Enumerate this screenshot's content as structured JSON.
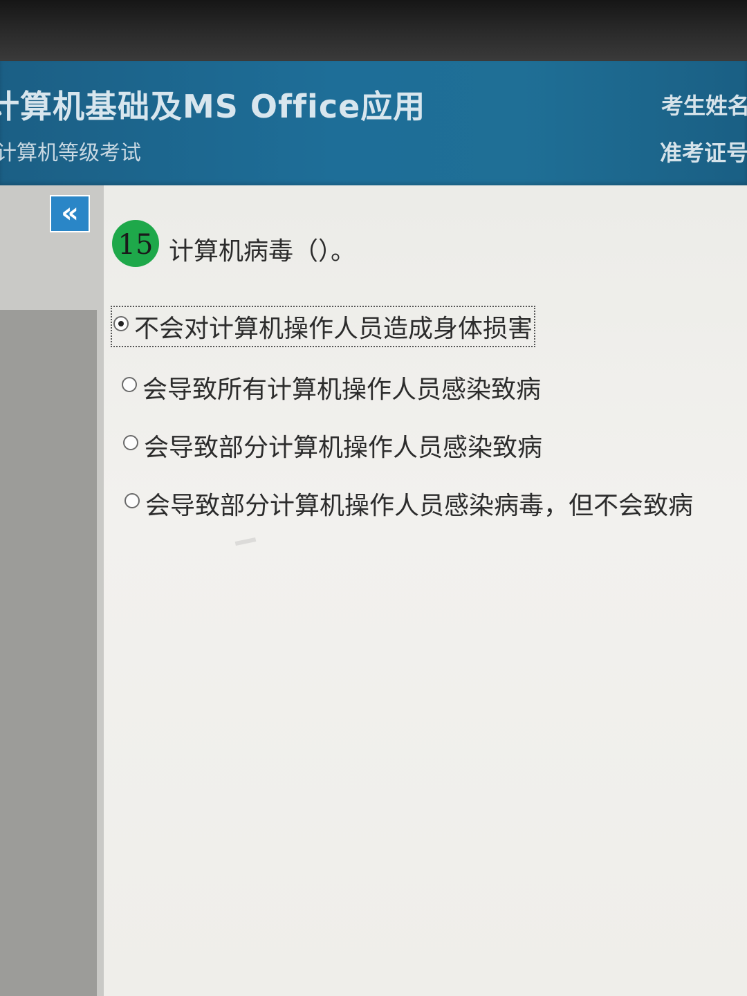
{
  "header": {
    "app_title": "计算机基础及MS Office应用",
    "app_subtitle": "计算机等级考试",
    "candidate_name_label": "考生姓名",
    "candidate_id_label": "准考证号"
  },
  "sidebar": {
    "collapse_label": "«"
  },
  "question": {
    "number": "15",
    "text": "计算机病毒（）。",
    "options": [
      {
        "label": "不会对计算机操作人员造成身体损害",
        "selected": true
      },
      {
        "label": "会导致所有计算机操作人员感染致病",
        "selected": false
      },
      {
        "label": "会导致部分计算机操作人员感染致病",
        "selected": false
      },
      {
        "label": "会导致部分计算机操作人员感染病毒，但不会致病",
        "selected": false
      }
    ]
  },
  "colors": {
    "header_bg": "#1e6e98",
    "badge_green": "#1ea84a",
    "collapse_blue": "#2a86c7"
  }
}
